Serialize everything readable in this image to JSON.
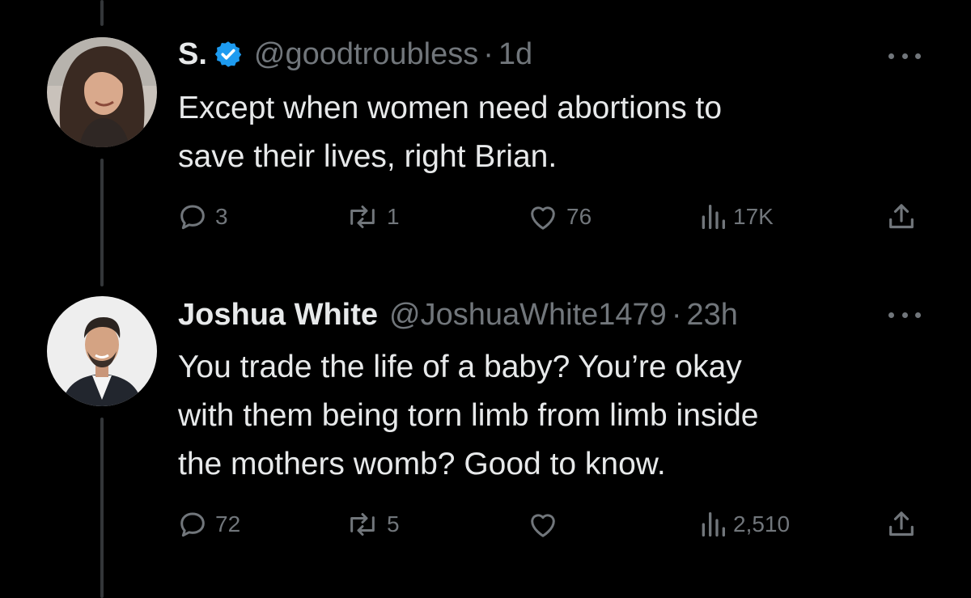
{
  "colors": {
    "background": "#000000",
    "primary_text": "#e7e9ea",
    "secondary_text": "#71767b",
    "verified_badge": "#1d9bf0",
    "thread_line": "#333639"
  },
  "tweets": [
    {
      "display_name": "S.",
      "verified": true,
      "handle": "@goodtroubless",
      "separator": "·",
      "time": "1d",
      "text_lines": [
        "Except when women need abortions to",
        "save their lives, right Brian."
      ],
      "actions": {
        "replies": "3",
        "reposts": "1",
        "likes": "76",
        "views": "17K"
      },
      "icons": [
        "reply-icon",
        "repost-icon",
        "like-icon",
        "views-icon",
        "share-icon",
        "more-icon"
      ]
    },
    {
      "display_name": "Joshua White",
      "verified": false,
      "handle": "@JoshuaWhite1479",
      "separator": "·",
      "time": "23h",
      "text_lines": [
        "You trade the life of a baby? You’re okay",
        "with them being torn limb from limb inside",
        "the mothers womb?  Good to know."
      ],
      "actions": {
        "replies": "72",
        "reposts": "5",
        "likes": "",
        "views": "2,510"
      },
      "icons": [
        "reply-icon",
        "repost-icon",
        "like-icon",
        "views-icon",
        "share-icon",
        "more-icon"
      ]
    }
  ]
}
